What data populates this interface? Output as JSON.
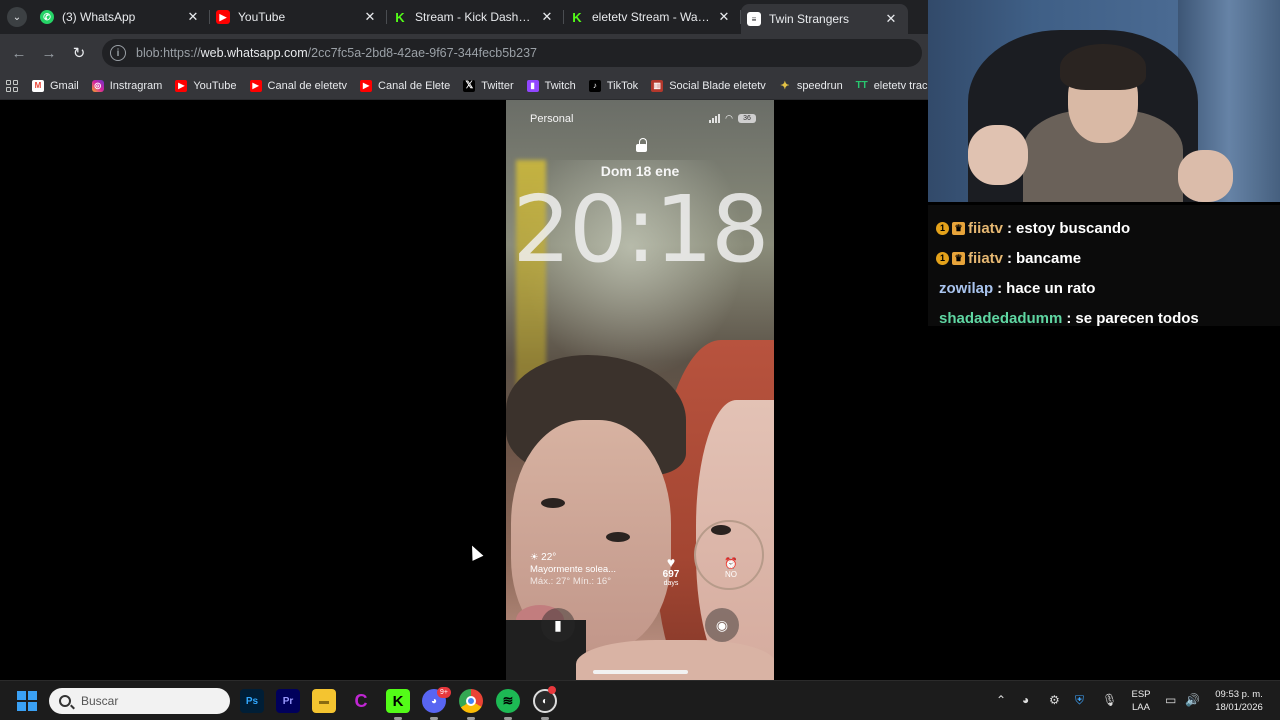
{
  "browser": {
    "tabs": [
      {
        "title": "(3) WhatsApp",
        "icon": "whatsapp-icon",
        "color": "#25d366"
      },
      {
        "title": "YouTube",
        "icon": "youtube-icon",
        "color": "#ff0000"
      },
      {
        "title": "Stream - Kick Dashboard",
        "icon": "kick-icon",
        "color": "#53fc18"
      },
      {
        "title": "eletetv Stream - Watch Liv",
        "icon": "kick-icon",
        "color": "#53fc18"
      },
      {
        "title": "Twin Strangers",
        "icon": "twin-strangers-icon",
        "color": "#ffffff"
      }
    ],
    "url": {
      "prefix": "blob:https://",
      "host": "web.whatsapp.com",
      "path": "/2cc7fc5a-2bd8-42ae-9f67-344fecb5b237"
    },
    "bookmarks": [
      {
        "label": "Gmail",
        "icon": "gmail-icon",
        "color": "#ea4335"
      },
      {
        "label": "Instragram",
        "icon": "instagram-icon",
        "color": "#d6249f"
      },
      {
        "label": "YouTube",
        "icon": "youtube-icon",
        "color": "#ff0000"
      },
      {
        "label": "Canal de eletetv",
        "icon": "youtube-icon",
        "color": "#ff0000"
      },
      {
        "label": "Canal de Elete",
        "icon": "youtube-icon",
        "color": "#ff0000"
      },
      {
        "label": "Twitter",
        "icon": "x-icon",
        "color": "#000000"
      },
      {
        "label": "Twitch",
        "icon": "twitch-icon",
        "color": "#9146ff"
      },
      {
        "label": "TikTok",
        "icon": "tiktok-icon",
        "color": "#000000"
      },
      {
        "label": "Social Blade eletetv",
        "icon": "socialblade-icon",
        "color": "#b3382c"
      },
      {
        "label": "speedrun",
        "icon": "speedrun-icon",
        "color": "#e3c245"
      },
      {
        "label": "eletetv tracker",
        "icon": "tracker-icon",
        "color": "#28c76f"
      }
    ]
  },
  "phone": {
    "carrier": "Personal",
    "battery": "36",
    "date": "Dom 18 ene",
    "time": "20:18",
    "weather": {
      "temp": "22°",
      "condition": "Mayormente solea...",
      "range": "Máx.: 27° Mín.: 16°"
    },
    "counter": {
      "value": "697",
      "unit": "days"
    },
    "alarm": "NO"
  },
  "chat": [
    {
      "user": "fiiatv",
      "text": "estoy buscando",
      "color": "#e6b872",
      "badges": true
    },
    {
      "user": "fiiatv",
      "text": "bancame",
      "color": "#e6b872",
      "badges": true
    },
    {
      "user": "zowilap",
      "text": "hace un rato",
      "color": "#a9c4ee",
      "badges": false
    },
    {
      "user": "shadadedadumm",
      "text": "se parecen todos",
      "color": "#5fd6a2",
      "badges": false
    }
  ],
  "taskbar": {
    "search_placeholder": "Buscar",
    "discord_badge": "9+",
    "lang_top": "ESP",
    "lang_bottom": "LAA",
    "time": "09:53 p. m.",
    "date": "18/01/2026"
  }
}
